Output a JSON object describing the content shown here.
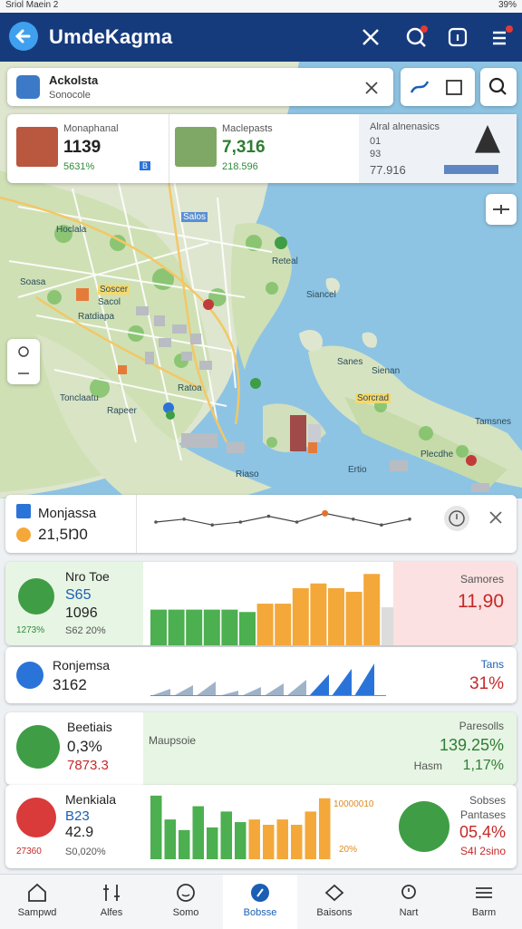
{
  "status_bar": {
    "left": "Sriol Maein 2",
    "right": "39%"
  },
  "app_bar": {
    "title": "UmdeKagma"
  },
  "search": {
    "title": "Ackolsta",
    "subtitle": "Sonocole"
  },
  "map_cards": [
    {
      "title": "Monaphanal",
      "value": "1139",
      "sub": "5631%",
      "tag": "B"
    },
    {
      "title": "Maclepasts",
      "value": "7,316",
      "sub": "218.596"
    },
    {
      "title": "Alral alnenasics",
      "line1": "01",
      "line2": "93",
      "value": "77.916"
    }
  ],
  "map_labels": [
    "Hoclala",
    "Soasa",
    "Soscer",
    "Siancel",
    "Ratdiapa",
    "Tonclaatu",
    "Rapeer",
    "Ratoa",
    "Sanes",
    "Sienan",
    "Sorcrad",
    "Tamsnes",
    "Riaso",
    "Ertio",
    "Salos",
    "Sacol",
    "Plecdhe",
    "Reteal"
  ],
  "chart_data": [
    {
      "type": "line",
      "title": "",
      "series": [
        {
          "values": [
            5,
            6,
            4,
            5,
            7,
            5,
            8,
            6,
            4,
            6
          ]
        }
      ]
    },
    {
      "type": "bar",
      "title": "",
      "series": [
        {
          "values": [
            30,
            30,
            30,
            30,
            30,
            28,
            35,
            35,
            48,
            52,
            48,
            45,
            60,
            32
          ]
        }
      ]
    },
    {
      "type": "bar",
      "title": "",
      "series": [
        {
          "values": [
            4,
            6,
            8,
            3,
            5,
            7,
            9,
            12,
            15,
            18
          ]
        }
      ]
    },
    {
      "type": "bar",
      "title": "",
      "series": [
        {
          "values": [
            48,
            30,
            22,
            40,
            24,
            36,
            28,
            30,
            26,
            30,
            26,
            36,
            46
          ]
        }
      ]
    }
  ],
  "strip": {
    "title": "Monjassa",
    "value": "21,5Ŋ0"
  },
  "panel1": {
    "title": "Nro Toe",
    "v1": "S65",
    "v2": "1096",
    "sub": "S62 20%",
    "left_small": "1273%",
    "right_title": "Samores",
    "right_value": "11,90"
  },
  "panel2": {
    "title": "Ronjemsa",
    "value": "3162",
    "right_title": "Tans",
    "right_value": "31%"
  },
  "panel3": {
    "title": "Beetiais",
    "value": "0,3%",
    "sub": "7873.3",
    "mid": "Maupsoie",
    "right_title": "Paresolls",
    "right_value": "139.25%",
    "right_sub": "Hasm",
    "right_sub_value": "1,17%"
  },
  "panel4": {
    "title": "Menkiala",
    "v1": "B23",
    "v2": "42.9",
    "sub": "S0,020%",
    "left_small": "27360",
    "mid_label": "10000010",
    "mid_foot": "20%",
    "right_title": "Sobses",
    "right_sub": "Pantases",
    "right_value": "05,4%",
    "right_foot": "S4I 2sino"
  },
  "bottom_nav": [
    {
      "label": "Sampwd"
    },
    {
      "label": "Alfes"
    },
    {
      "label": "Somo"
    },
    {
      "label": "Bobsse"
    },
    {
      "label": "Baisons"
    },
    {
      "label": "Nart"
    },
    {
      "label": "Barm"
    }
  ],
  "colors": {
    "primary": "#163b7d",
    "green": "#4caf50",
    "orange": "#f4a83a",
    "red": "#d93a3a",
    "blue": "#2a74d9"
  }
}
